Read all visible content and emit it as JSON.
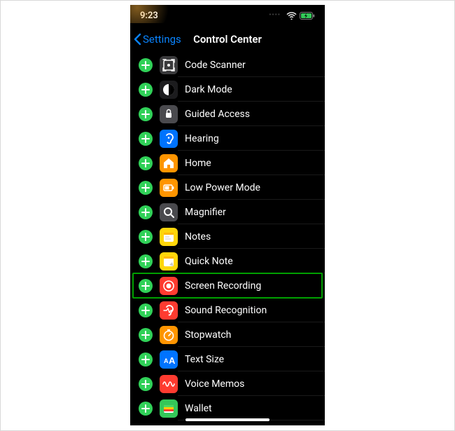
{
  "status": {
    "time": "9:23",
    "dots": "••••"
  },
  "nav": {
    "back_label": "Settings",
    "title": "Control Center"
  },
  "rows": [
    {
      "label": "Code Scanner",
      "icon": "codescanner",
      "bg": "#3a3a3c",
      "highlight": false
    },
    {
      "label": "Dark Mode",
      "icon": "darkmode",
      "bg": "#1c1c1e",
      "highlight": false
    },
    {
      "label": "Guided Access",
      "icon": "guided",
      "bg": "#4a4a4e",
      "highlight": false
    },
    {
      "label": "Hearing",
      "icon": "hearing",
      "bg": "#0073ff",
      "highlight": false
    },
    {
      "label": "Home",
      "icon": "home",
      "bg": "#ff9500",
      "highlight": false
    },
    {
      "label": "Low Power Mode",
      "icon": "lowpower",
      "bg": "#ff9500",
      "highlight": false
    },
    {
      "label": "Magnifier",
      "icon": "magnifier",
      "bg": "#4a4a4e",
      "highlight": false
    },
    {
      "label": "Notes",
      "icon": "notes",
      "bg": "#ffd60a",
      "highlight": false
    },
    {
      "label": "Quick Note",
      "icon": "quicknote",
      "bg": "#ffd60a",
      "highlight": false
    },
    {
      "label": "Screen Recording",
      "icon": "record",
      "bg": "#ff3b30",
      "highlight": true
    },
    {
      "label": "Sound Recognition",
      "icon": "soundrec",
      "bg": "#ff3b30",
      "highlight": false
    },
    {
      "label": "Stopwatch",
      "icon": "stopwatch",
      "bg": "#ff9500",
      "highlight": false
    },
    {
      "label": "Text Size",
      "icon": "textsize",
      "bg": "#0073ff",
      "highlight": false
    },
    {
      "label": "Voice Memos",
      "icon": "voicememos",
      "bg": "#ff3b30",
      "highlight": false
    },
    {
      "label": "Wallet",
      "icon": "wallet",
      "bg": "#34c759",
      "highlight": false
    }
  ]
}
